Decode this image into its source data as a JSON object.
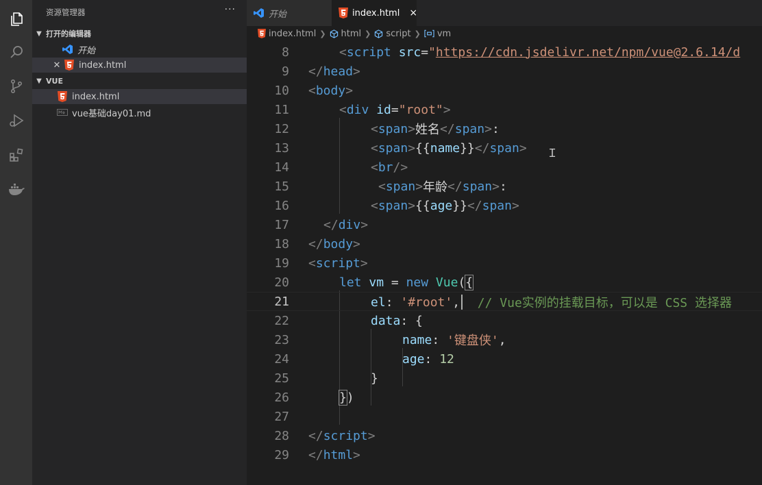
{
  "activity_bar": {
    "icons": [
      "explorer-icon",
      "search-icon",
      "source-control-icon",
      "run-debug-icon",
      "extensions-icon",
      "docker-icon"
    ]
  },
  "sidebar": {
    "title": "资源管理器",
    "more": "···",
    "open_editors": {
      "header": "打开的编辑器",
      "items": [
        {
          "label": "开始",
          "icon": "vscode-icon"
        },
        {
          "label": "index.html",
          "icon": "html5-icon"
        }
      ]
    },
    "folder": {
      "header": "VUE",
      "items": [
        {
          "label": "index.html",
          "icon": "html5-icon"
        },
        {
          "label": "vue基础day01.md",
          "icon": "markdown-icon"
        }
      ]
    }
  },
  "tabs": [
    {
      "label": "开始",
      "icon": "vscode-icon"
    },
    {
      "label": "index.html",
      "icon": "html5-icon",
      "close": "×"
    }
  ],
  "breadcrumb": [
    "index.html",
    "html",
    "script",
    "vm"
  ],
  "editor": {
    "line_numbers": [
      "8",
      "9",
      "10",
      "11",
      "12",
      "13",
      "14",
      "15",
      "16",
      "17",
      "18",
      "19",
      "20",
      "21",
      "22",
      "23",
      "24",
      "25",
      "26",
      "27",
      "28",
      "29"
    ],
    "current_line": "21",
    "tokens": {
      "script_src_attr": "src",
      "script_src_url": "https://cdn.jsdelivr.net/npm/vue@2.6.14/d",
      "div_id_value": "\"root\"",
      "name_label": "姓名",
      "name_binding": "name",
      "age_label": "年龄",
      "age_binding": "age",
      "let_kw": "let",
      "vm_var": "vm",
      "new_kw": "new",
      "vue_cls": "Vue",
      "el_key": "el",
      "el_value": "'#root'",
      "comment": "// Vue实例的挂载目标，可以是 CSS 选择器",
      "data_key": "data",
      "name_key": "name",
      "name_value": "'键盘侠'",
      "age_key": "age",
      "age_value": "12"
    }
  },
  "colors": {
    "activity_bg": "#333333",
    "sidebar_bg": "#252526",
    "editor_bg": "#1e1e1e",
    "html5_orange": "#e44d26",
    "vscode_blue": "#3794ff"
  }
}
